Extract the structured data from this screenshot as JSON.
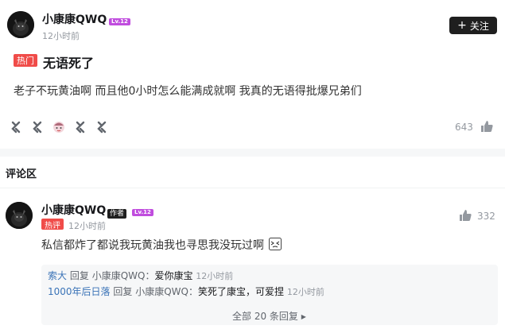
{
  "post": {
    "username": "小康康QWQ",
    "level": "Lv.12",
    "time": "12小时前",
    "follow_label": "关注",
    "hot_tag": "热门",
    "title": "无语死了",
    "content": "老子不玩黄油啊 而且他0小时怎么能满成就啊 我真的无语得批爆兄弟们",
    "reactions": [
      "reaction-icon",
      "reaction-icon",
      "anime-reaction-icon",
      "reaction-icon",
      "reaction-icon"
    ],
    "like_count": "643"
  },
  "comments_section": {
    "title": "评论区"
  },
  "comment": {
    "username": "小康康QWQ",
    "author_tag": "作者",
    "level": "Lv.12",
    "hot_tag": "热评",
    "time": "12小时前",
    "like_count": "332",
    "content": "私信都炸了都说我玩黄油我也寻思我没玩过啊",
    "replies": [
      {
        "user": "索大",
        "reply_word": "回复",
        "to": "小康康QWQ：",
        "text": "爱你康宝",
        "time": "12小时前"
      },
      {
        "user": "1000年后日落",
        "reply_word": "回复",
        "to": "小康康QWQ：",
        "text": "笑死了康宝，可爱捏",
        "time": "12小时前"
      }
    ],
    "more_label": "全部 20 条回复"
  },
  "colors": {
    "accent_hot": "#f04c49",
    "level_badge": "#c04dde",
    "link_blue": "#3a73b7"
  }
}
